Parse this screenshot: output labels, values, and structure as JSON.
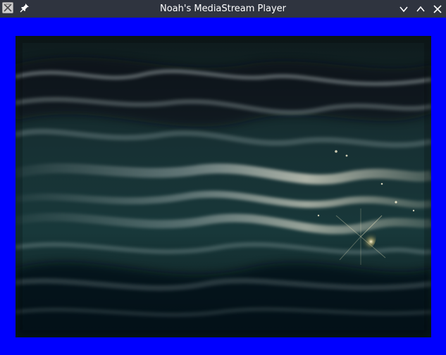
{
  "window": {
    "title": "Noah's MediaStream Player"
  },
  "titlebar": {
    "icons": {
      "app": "app-icon",
      "pin": "pin-icon",
      "minimize": "chevron-down-icon",
      "maximize": "chevron-up-icon",
      "close": "close-icon"
    }
  },
  "player": {
    "background_color": "#0000ff",
    "frame_description_color": "#0b1415"
  }
}
